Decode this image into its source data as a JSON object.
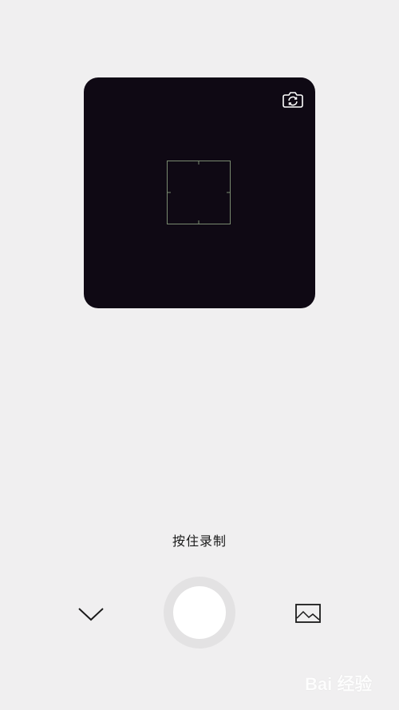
{
  "camera": {
    "switch_icon": "camera-switch-icon",
    "focus_icon": "focus-frame-icon"
  },
  "record": {
    "hint": "按住录制"
  },
  "controls": {
    "collapse_icon": "chevron-down-icon",
    "shutter_icon": "record-button",
    "gallery_icon": "image-icon"
  },
  "watermark": {
    "text": "Bai 经验"
  },
  "colors": {
    "background": "#f0eff0",
    "viewfinder": "#0f0914",
    "focus_frame": "#7a8a70",
    "shutter_ring": "#e3e2e3",
    "shutter_core": "#ffffff"
  }
}
